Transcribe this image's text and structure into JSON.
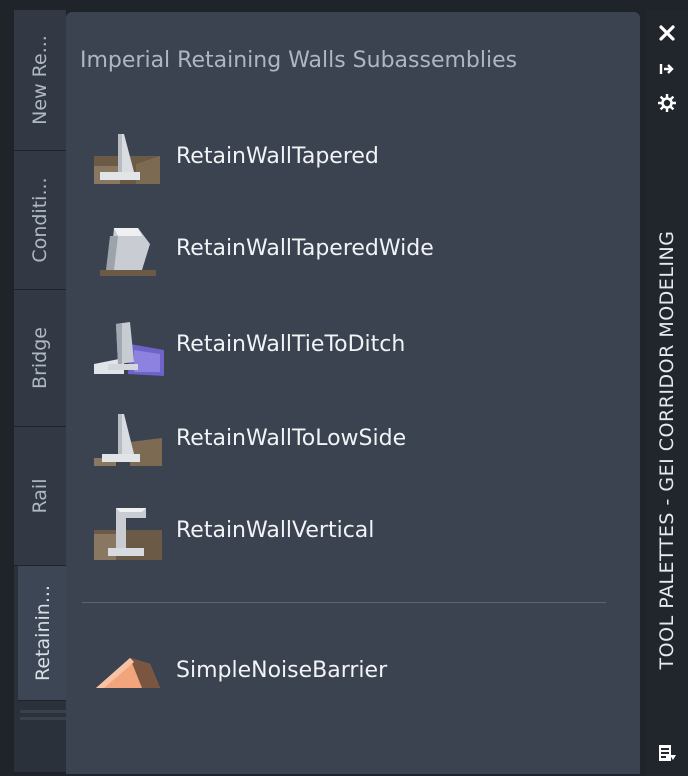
{
  "tabs": [
    {
      "label": "New Re..."
    },
    {
      "label": "Conditi..."
    },
    {
      "label": "Bridge"
    },
    {
      "label": "Rail"
    },
    {
      "label": "Retainin..."
    }
  ],
  "palette": {
    "title": "Imperial Retaining Walls Subassemblies",
    "tools": [
      {
        "label": "RetainWallTapered",
        "icon": "retain-wall-tapered-icon"
      },
      {
        "label": "RetainWallTaperedWide",
        "icon": "retain-wall-tapered-wide-icon"
      },
      {
        "label": "RetainWallTieToDitch",
        "icon": "retain-wall-tie-to-ditch-icon"
      },
      {
        "label": "RetainWallToLowSide",
        "icon": "retain-wall-to-low-side-icon"
      },
      {
        "label": "RetainWallVertical",
        "icon": "retain-wall-vertical-icon"
      },
      {
        "label": "SimpleNoiseBarrier",
        "icon": "simple-noise-barrier-icon"
      }
    ]
  },
  "titlebar": {
    "title": "TOOL PALETTES - GEI CORRIDOR MODELING",
    "close_icon": "close-icon",
    "autohide_icon": "auto-hide-icon",
    "properties_icon": "properties-gear-icon",
    "menu_icon": "palette-menu-icon"
  },
  "colors": {
    "panel_bg": "#3b4351",
    "tab_bg": "#323945",
    "active_tab_bg": "#3d4655",
    "titlebar_bg": "#21252c",
    "label_text": "#f1f3f5",
    "title_text": "#aeb6c1"
  }
}
